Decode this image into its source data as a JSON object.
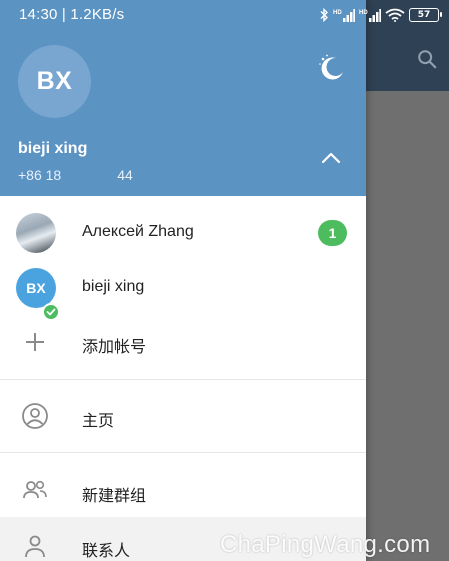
{
  "status_bar": {
    "time_speed": "14:30 | 1.2KB/s",
    "battery": "57",
    "signal_label": "HD"
  },
  "profile": {
    "avatar_initials": "BX",
    "name": "bieji xing",
    "phone": "+86 18        44"
  },
  "accounts": [
    {
      "name": "Алексей Zhang",
      "unread": "1"
    },
    {
      "name": "bieji xing",
      "initials": "BX"
    }
  ],
  "add_account_label": "添加帐号",
  "menu": {
    "home": "主页",
    "new_group": "新建群组",
    "contacts": "联系人"
  },
  "watermark": "ChaPingWang.com",
  "colors": {
    "drawer_header": "#5b93c3",
    "background_header": "#2f4154",
    "badge": "#4cbc5e"
  },
  "icons": [
    "bluetooth-icon",
    "signal-icon",
    "wifi-icon",
    "battery-icon",
    "night-mode-icon",
    "chevron-up-icon",
    "add-icon",
    "profile-icon",
    "group-icon",
    "contacts-icon",
    "search-icon",
    "check-icon"
  ]
}
